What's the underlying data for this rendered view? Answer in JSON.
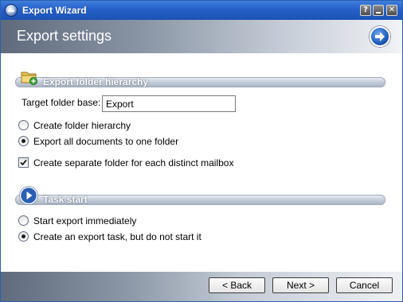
{
  "window": {
    "title": "Export Wizard",
    "help_label": "?",
    "close_label": "✕"
  },
  "header": {
    "title": "Export settings"
  },
  "export_folder_hierarchy": {
    "section_label": "Export folder hierarchy",
    "target_label": "Target folder base:",
    "target_value": "Export",
    "options": [
      {
        "label": "Create folder hierarchy",
        "selected": false
      },
      {
        "label": "Export all documents to one folder",
        "selected": true
      }
    ],
    "separate_folder": {
      "label": "Create separate folder for each distinct mailbox",
      "checked": true
    }
  },
  "task_start": {
    "section_label": "Task start",
    "options": [
      {
        "label": "Start export immediately",
        "selected": false
      },
      {
        "label": "Create an export task, but do not start it",
        "selected": true
      }
    ]
  },
  "footer": {
    "back_label": "< Back",
    "next_label": "Next >",
    "cancel_label": "Cancel"
  },
  "colors": {
    "titlebar": "#2560c8",
    "header_gradient_dark": "#5f6b7c",
    "header_gradient_light": "#f1f3f6"
  }
}
